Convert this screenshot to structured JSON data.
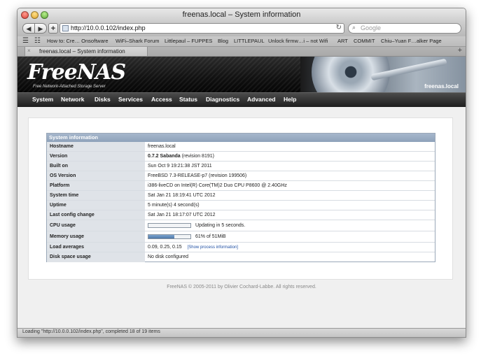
{
  "window": {
    "title": "freenas.local – System information"
  },
  "toolbar": {
    "back_label": "◀",
    "forward_label": "▶",
    "add_label": "+",
    "url": "http://10.0.0.102/index.php",
    "reload_glyph": "↻",
    "search_icon": "⌕",
    "search_placeholder": "Google"
  },
  "bookmarks": {
    "book_icon": "☰",
    "grid_icon": "☷",
    "items": [
      "How to: Cre… Onsoftware",
      "WiFi–Shark Forum",
      "Littlepaul – FUPPES",
      "Blog",
      "LITTLEPAUL",
      "Unlock firmw…i – not Wifi",
      "ART",
      "COMMIT",
      "Chiu–Yuan F…alker Page"
    ]
  },
  "tab": {
    "title": "freenas.local – System information",
    "close_glyph": "×",
    "newtab_glyph": "+"
  },
  "header": {
    "logo": "FreeNAS",
    "tagline": "Free Network-Attached Storage Server",
    "hostname": "freenas.local"
  },
  "nav": [
    "System",
    "Network",
    "Disks",
    "Services",
    "Access",
    "Status",
    "Diagnostics",
    "Advanced",
    "Help"
  ],
  "sysinfo": {
    "title": "System information",
    "rows": [
      {
        "key": "Hostname",
        "value": "freenas.local"
      },
      {
        "key": "Version",
        "value_bold": "0.7.2 Sabanda",
        "value": "(revision 8191)"
      },
      {
        "key": "Built on",
        "value": "Sun Oct 9 19:21:38 JST 2011"
      },
      {
        "key": "OS Version",
        "value": "FreeBSD 7.3-RELEASE-p7 (revision 199506)"
      },
      {
        "key": "Platform",
        "value": "i386-liveCD on Intel(R) Core(TM)2 Duo CPU P8600 @ 2.40GHz"
      },
      {
        "key": "System time",
        "value": "Sat Jan 21 18:19:41 UTC 2012"
      },
      {
        "key": "Uptime",
        "value": "5 minute(s) 4 second(s)"
      },
      {
        "key": "Last config change",
        "value": "Sat Jan 21 18:17:07 UTC 2012"
      },
      {
        "key": "CPU usage",
        "value": "Updating in 5 seconds.",
        "fill": 0
      },
      {
        "key": "Memory usage",
        "value": "61% of 51MiB",
        "fill": 0.61
      },
      {
        "key": "Load averages",
        "value": "0.09, 0.25, 0.15",
        "link": "[Show process information]"
      },
      {
        "key": "Disk space usage",
        "value": "No disk configured"
      }
    ]
  },
  "footer": "FreeNAS © 2005-2011 by Olivier Cochard-Labbe. All rights reserved.",
  "status": "Loading \"http://10.0.0.102/index.php\", completed 18 of 19 items",
  "colors": {
    "header_bg": "#111111",
    "section_header": "#8ea2ba",
    "key_cell": "#dfe3e8",
    "link": "#1f4fa3"
  }
}
